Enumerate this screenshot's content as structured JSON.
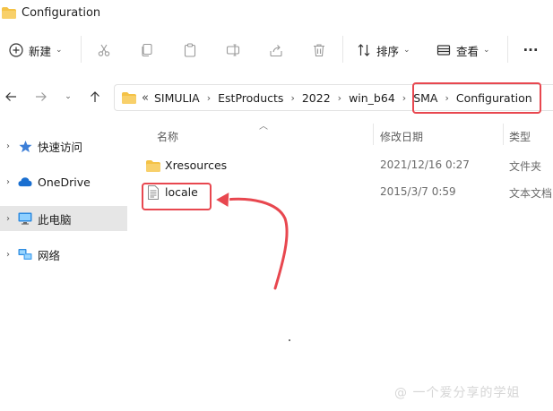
{
  "window": {
    "title": "Configuration"
  },
  "toolbar": {
    "new_label": "新建",
    "sort_label": "排序",
    "view_label": "查看",
    "more_label": "···"
  },
  "address": {
    "overflow": "«",
    "crumbs": [
      "SIMULIA",
      "EstProducts",
      "2022",
      "win_b64",
      "SMA",
      "Configuration"
    ],
    "separator": "›"
  },
  "sidebar": {
    "items": [
      {
        "label": "快速访问",
        "icon": "star-icon"
      },
      {
        "label": "OneDrive",
        "icon": "cloud-icon"
      },
      {
        "label": "此电脑",
        "icon": "pc-icon",
        "selected": true
      },
      {
        "label": "网络",
        "icon": "network-icon"
      }
    ]
  },
  "columns": {
    "name": "名称",
    "date": "修改日期",
    "type": "类型"
  },
  "files": [
    {
      "name": "Xresources",
      "date": "2021/12/16 0:27",
      "type": "文件夹",
      "icon": "folder-icon"
    },
    {
      "name": "locale",
      "date": "2015/3/7 0:59",
      "type": "文本文档",
      "icon": "text-file-icon"
    }
  ],
  "watermark": "@ 一个爱分享的学姐",
  "colors": {
    "highlight": "#e8474f",
    "folder": "#f4c246",
    "selected_bg": "#e6e6e6"
  }
}
